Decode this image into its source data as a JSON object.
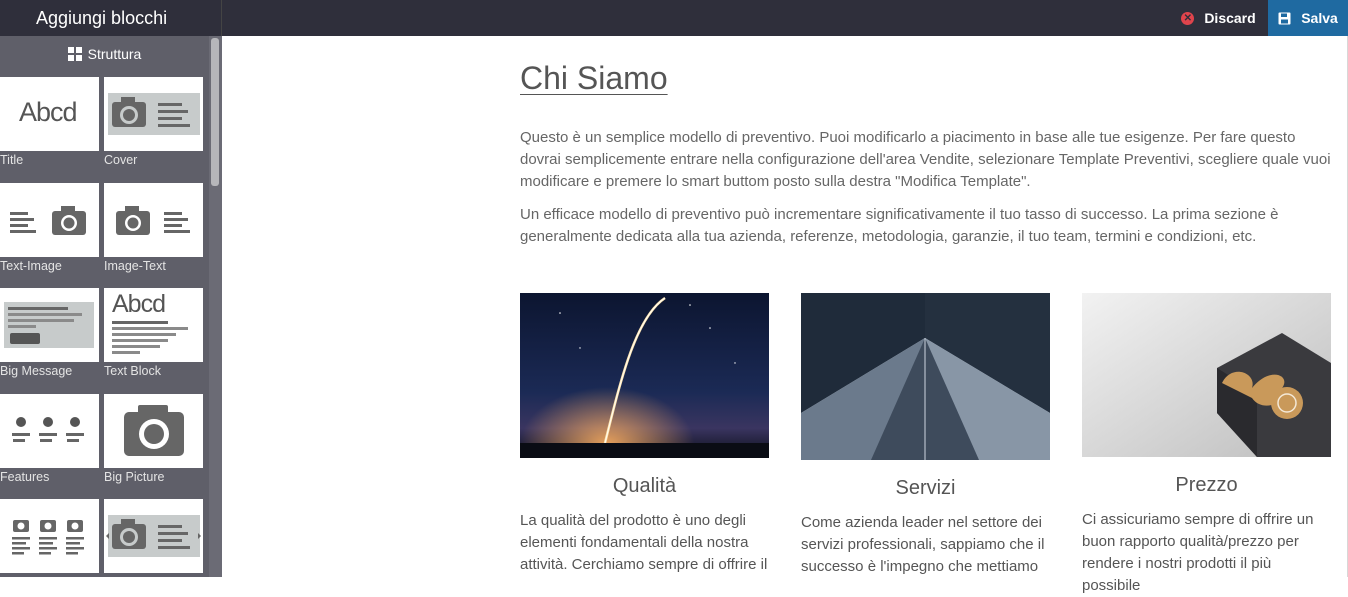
{
  "topbar": {
    "title": "Aggiungi blocchi",
    "discard_label": "Discard",
    "save_label": "Salva"
  },
  "sidebar": {
    "header": "Struttura",
    "blocks": [
      {
        "label": "Title"
      },
      {
        "label": "Cover"
      },
      {
        "label": "Text-Image"
      },
      {
        "label": "Image-Text"
      },
      {
        "label": "Big Message"
      },
      {
        "label": "Text Block"
      },
      {
        "label": "Features"
      },
      {
        "label": "Big Picture"
      },
      {
        "label": ""
      },
      {
        "label": ""
      }
    ],
    "title_thumb_text": "Abcd"
  },
  "main": {
    "title": "Chi Siamo",
    "paragraphs": [
      "Questo è un semplice modello di preventivo. Puoi modificarlo a piacimento in base alle tue esigenze. Per fare questo dovrai semplicemente entrare nella configurazione dell'area Vendite, selezionare Template Preventivi, scegliere quale vuoi modificare e premere lo smart buttom posto sulla destra \"Modifica Template\".",
      "Un efficace modello di preventivo può incrementare significativamente il tuo tasso di successo. La prima sezione è generalmente dedicata alla tua azienda, referenze, metodologia, garanzie, il tuo team, termini e condizioni, etc."
    ],
    "columns": [
      {
        "heading": "Qualità",
        "text": "La qualità del prodotto è uno degli elementi fondamentali della nostra attività. Cerchiamo sempre di offrire il"
      },
      {
        "heading": "Servizi",
        "text": "Come azienda leader nel settore dei servizi professionali, sappiamo che il successo è l'impegno che mettiamo"
      },
      {
        "heading": "Prezzo",
        "text": "Ci assicuriamo sempre di offrire un buon rapporto qualità/prezzo per rendere i nostri prodotti il più possibile"
      }
    ]
  },
  "colors": {
    "topbar": "#2f2f3b",
    "save": "#1f6aa1",
    "discard_icon": "#e0444c",
    "sidebar": "#5f5f69"
  }
}
